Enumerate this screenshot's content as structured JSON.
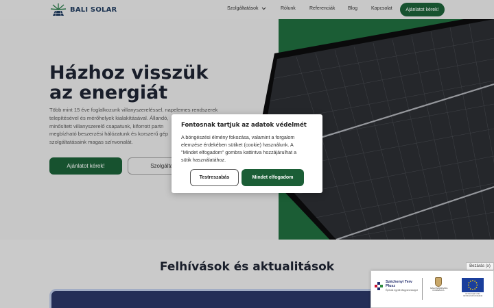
{
  "colors": {
    "brand_green": "#1b5e36",
    "panel_green": "#1f6a3d",
    "logo_navy": "#1f3a5c",
    "heading_dark": "#1d2330"
  },
  "header": {
    "logo_text": "BALI SOLAR",
    "nav": {
      "services": "Szolgáltatások",
      "about": "Rólunk",
      "references": "Referenciák",
      "blog": "Blog",
      "contact": "Kapcsolat"
    },
    "cta_label": "Ajánlatot kérek!"
  },
  "hero": {
    "title_line1": "Házhoz visszük",
    "title_line2": "az energiát",
    "text_lines": [
      "Több mint 15 éve foglalkozunk villanyszereléssel, napelemes rendszerek",
      "telepítésével és mérőhelyek kialakításával. Állandó,",
      "minősített villanyszerelő csapatunk, kiforrott partn",
      "megbízható beszerzési hálózatunk és korszerű gép",
      "szolgáltatásaink magas színvonalát."
    ],
    "primary_button": "Ajánlatot kérek!",
    "secondary_button": "Szolgáltatá"
  },
  "cookie_modal": {
    "title": "Fontosnak tartjuk az adatok védelmét",
    "body_lines": [
      "A böngészési élmény fokozása, valamint a forgalom",
      "elemzése érdekében sütiket (cookie) használunk. A",
      "\"Mindet elfogadom\" gombra kattintva hozzájárulhat a",
      "sütik használatához."
    ],
    "customize_label": "Testreszabás",
    "accept_label": "Mindet elfogadom"
  },
  "announcements": {
    "title": "Felhívások és aktualitások"
  },
  "funding": {
    "close_label": "Bezárás (x)",
    "plan_name_line1": "Széchenyi Terv",
    "plan_name_line2": "Plusz",
    "plan_subtitle": "Építsük együtt Magyarországot",
    "gov_label": "MAGYARORSZÁG KORMÁNYA",
    "eu_label": "Az Európai Unió társfinanszírozásával"
  }
}
